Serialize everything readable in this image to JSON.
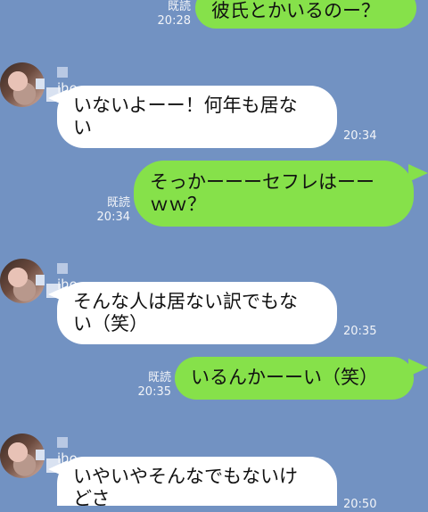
{
  "colors": {
    "background": "#7292c2",
    "outgoing_bubble": "#86e14a",
    "incoming_bubble": "#ffffff",
    "meta_text": "#f2f4f8"
  },
  "messages": [
    {
      "direction": "out",
      "text": "彼氏とかいるのー？",
      "read": "既読",
      "time": "20:28"
    },
    {
      "direction": "in",
      "sender": "iho",
      "text": "いないよーー！何年も居な\nい",
      "time": "20:34"
    },
    {
      "direction": "out",
      "text": "そっかーーーセフレはーー\nｗｗ？",
      "read": "既読",
      "time": "20:34"
    },
    {
      "direction": "in",
      "sender": "iho",
      "text": "そんな人は居ない訳でもな\nい（笑）",
      "time": "20:35"
    },
    {
      "direction": "out",
      "text": "いるんかーーい（笑）",
      "read": "既読",
      "time": "20:35"
    },
    {
      "direction": "in",
      "sender": "iho",
      "text": "いやいやそんなでもないけ\nどさ",
      "time": "20:50"
    }
  ]
}
